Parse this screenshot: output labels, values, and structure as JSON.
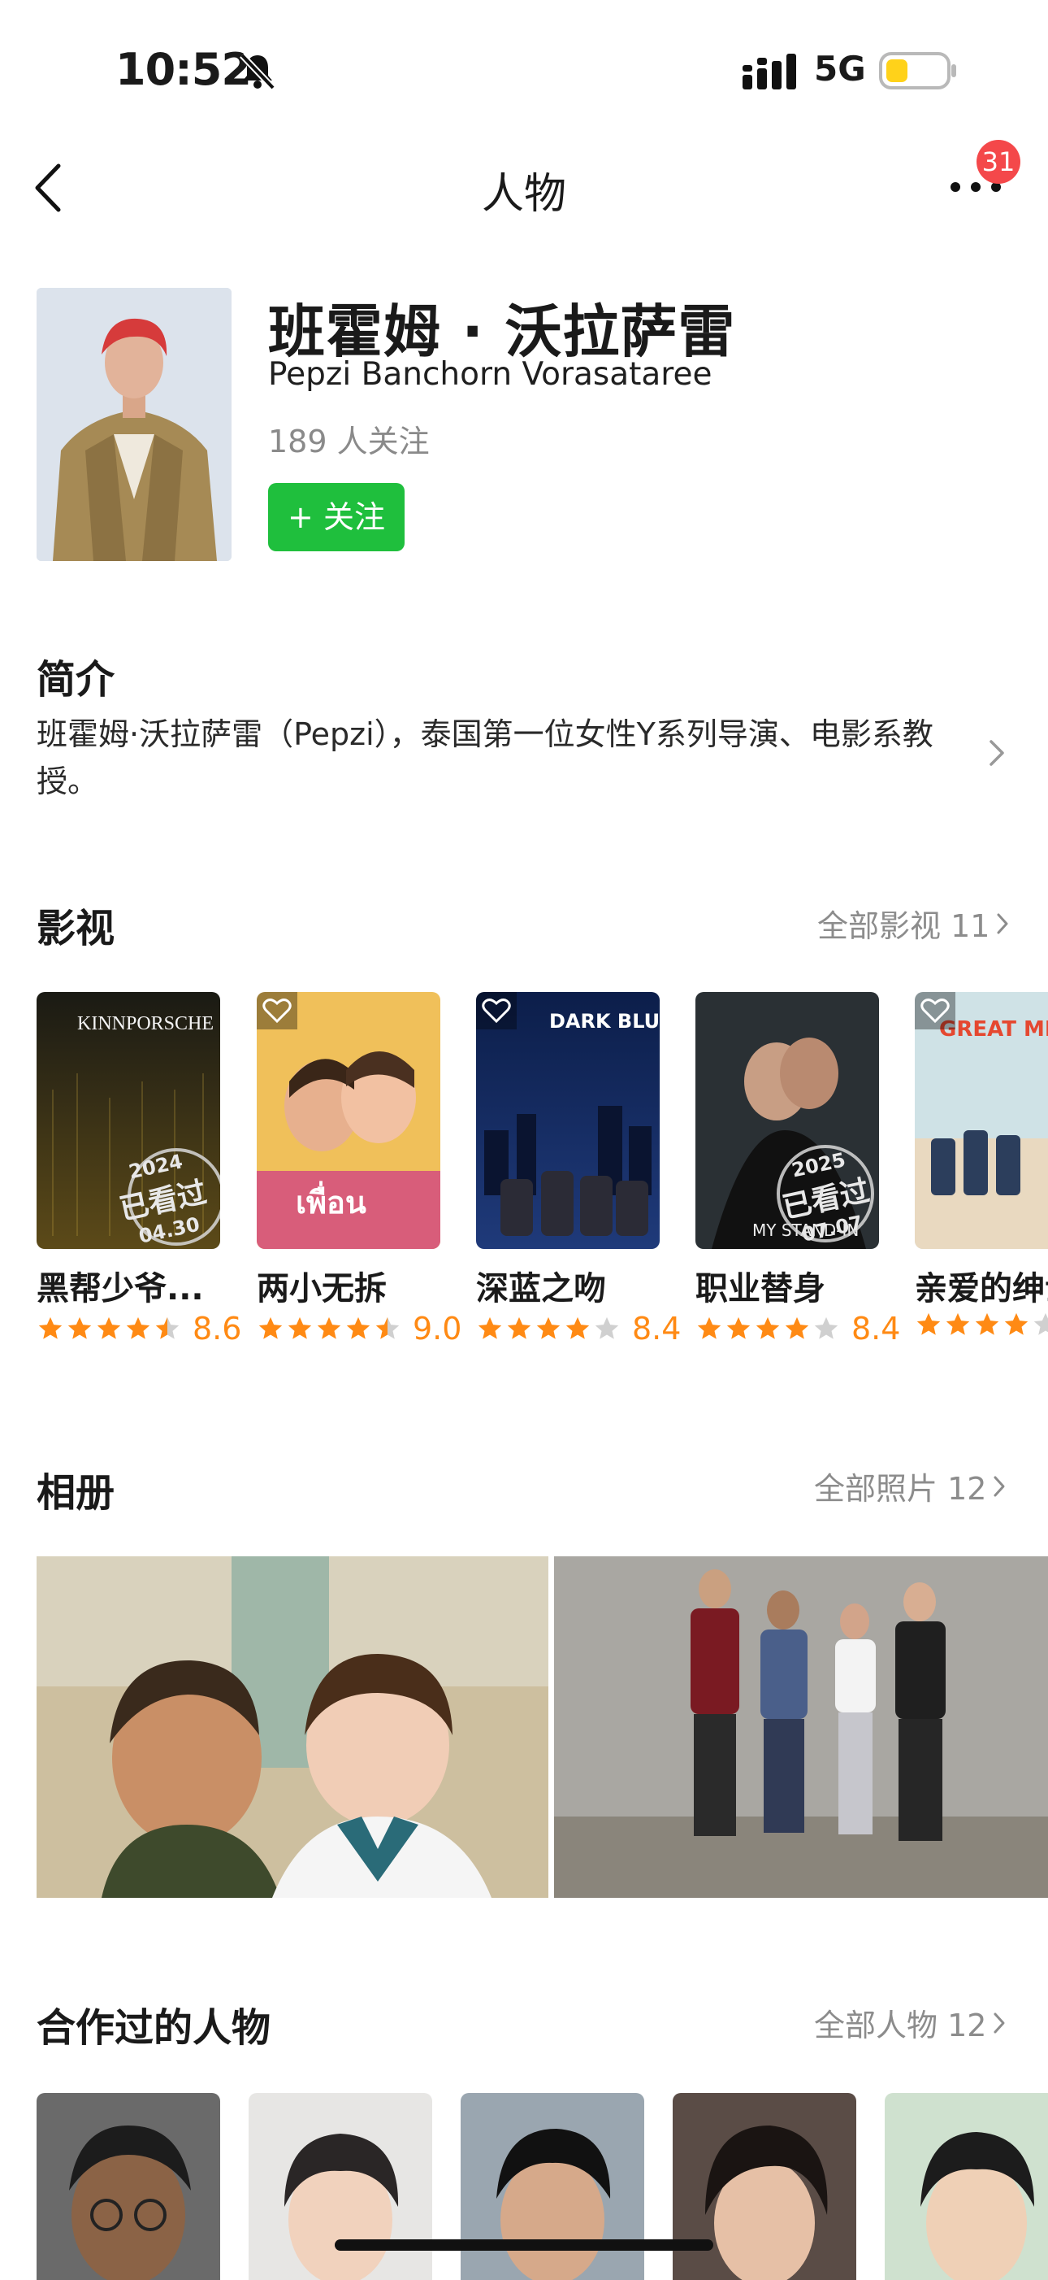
{
  "status_bar": {
    "time": "10:52",
    "network": "5G"
  },
  "nav": {
    "title": "人物",
    "badge_count": "31"
  },
  "profile": {
    "name_cn": "班霍姆 · 沃拉萨雷",
    "name_en": "Pepzi Banchorn Vorasataree",
    "followers": "189 人关注",
    "follow_label": "+ 关注"
  },
  "intro": {
    "title": "简介",
    "text": "班霍姆·沃拉萨雷（Pepzi），泰国第一位女性Y系列导演、电影系教授。"
  },
  "films": {
    "title": "影视",
    "link": "全部影视 11",
    "items": [
      {
        "title": "黑帮少爷...",
        "score": "8.6",
        "stars": 4.5,
        "poster_text": "KINNPORSCHE",
        "watched": "已看过",
        "watched_year": "2024",
        "watched_date": "04.30"
      },
      {
        "title": "两小无拆",
        "score": "9.0",
        "stars": 4.5,
        "poster_text": "เพื่อน"
      },
      {
        "title": "深蓝之吻",
        "score": "8.4",
        "stars": 4,
        "poster_text": "DARK BLUE KISS"
      },
      {
        "title": "职业替身",
        "score": "8.4",
        "stars": 4,
        "poster_text": "MY STAND-IN",
        "watched": "已看过",
        "watched_year": "2025",
        "watched_date": "07.07"
      },
      {
        "title": "亲爱的绅士",
        "score": "",
        "stars": 4,
        "poster_text": "GREAT MEN ACADEMY"
      }
    ]
  },
  "album": {
    "title": "相册",
    "link": "全部照片 12"
  },
  "collaborators": {
    "title": "合作过的人物",
    "link": "全部人物 12"
  },
  "colors": {
    "accent_green": "#1fbf3d",
    "star_orange": "#ff8a14",
    "badge_red": "#f4484a"
  }
}
